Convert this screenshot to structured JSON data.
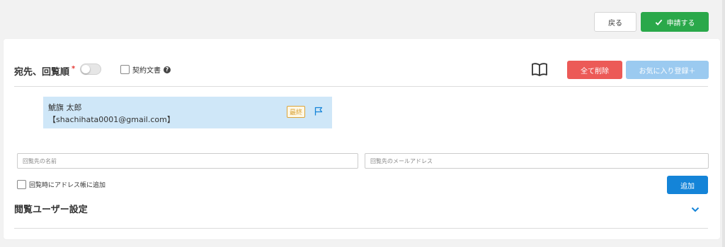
{
  "top_actions": {
    "back_label": "戻る",
    "apply_label": "申請する"
  },
  "recipients_section": {
    "title": "宛先、回覧順",
    "required_mark": "*",
    "contract_doc_label": "契約文書",
    "delete_all_label": "全て削除",
    "favorite_register_label": "お気に入り登録＋",
    "recipients": [
      {
        "name": "鯱旗 太郎",
        "email": "【shachihata0001@gmail.com】",
        "badge": "最終"
      }
    ],
    "name_placeholder": "回覧先の名前",
    "email_placeholder": "回覧先のメールアドレス",
    "addressbook_label": "回覧時にアドレス帳に追加",
    "add_label": "追加"
  },
  "viewer_section": {
    "title": "閲覧ユーザー設定"
  },
  "colors": {
    "apply": "#2aa84a",
    "delete": "#ec5a57",
    "favorite": "#9bcaf0",
    "add": "#1484d8",
    "recipient_bg": "#cfe7f8"
  }
}
